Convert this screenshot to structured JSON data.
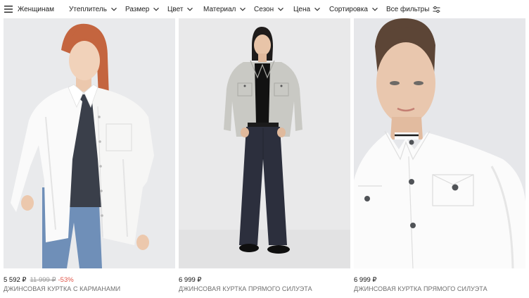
{
  "filters": {
    "category": "Женщинам",
    "items": [
      {
        "label": "Утеплитель"
      },
      {
        "label": "Размер"
      },
      {
        "label": "Цвет"
      },
      {
        "label": "Материал"
      },
      {
        "label": "Сезон"
      },
      {
        "label": "Цена"
      },
      {
        "label": "Сортировка"
      }
    ],
    "all_filters": "Все фильтры"
  },
  "products": [
    {
      "price": "5 592 ₽",
      "old_price": "11 999 ₽",
      "discount": "-53%",
      "title": "ДЖИНСОВАЯ КУРТКА С КАРМАНАМИ"
    },
    {
      "price": "6 999 ₽",
      "title": "ДЖИНСОВАЯ КУРТКА ПРЯМОГО СИЛУЭТА"
    },
    {
      "price": "6 999 ₽",
      "title": "ДЖИНСОВАЯ КУРТКА ПРЯМОГО СИЛУЭТА"
    }
  ],
  "colors": {
    "discount": "#e0564a",
    "old_price": "#9a9a9a",
    "title": "#6f6f6f"
  }
}
